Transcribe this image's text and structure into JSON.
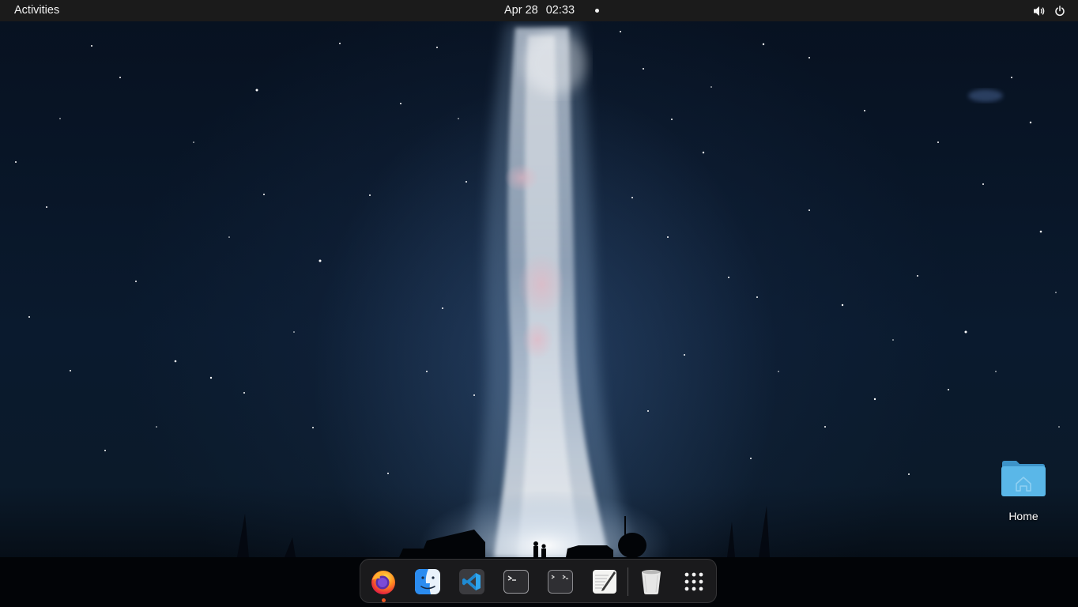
{
  "topbar": {
    "activities_label": "Activities",
    "date": "Apr 28",
    "time": "02:33",
    "indicators": [
      "volume-icon",
      "power-icon"
    ]
  },
  "desktop": {
    "icons": [
      {
        "label": "Home",
        "icon": "home-folder-icon"
      }
    ]
  },
  "dock": {
    "items": [
      {
        "name": "firefox",
        "icon": "firefox-icon",
        "running": true
      },
      {
        "name": "finder",
        "icon": "finder-icon",
        "running": false
      },
      {
        "name": "vscode",
        "icon": "vscode-icon",
        "running": false
      },
      {
        "name": "terminal",
        "icon": "terminal-icon",
        "running": false
      },
      {
        "name": "terminal-2",
        "icon": "terminal-alt-icon",
        "running": false
      },
      {
        "name": "text-editor",
        "icon": "text-editor-icon",
        "running": false
      },
      {
        "name": "trash",
        "icon": "trash-icon",
        "running": false
      },
      {
        "name": "show-apps",
        "icon": "app-grid-icon",
        "running": false
      }
    ]
  },
  "colors": {
    "topbar_bg": "#1b1b1b",
    "dock_bg": "#1c1c1e",
    "running_indicator": "#e95420",
    "folder_blue": "#5ab7e8"
  }
}
